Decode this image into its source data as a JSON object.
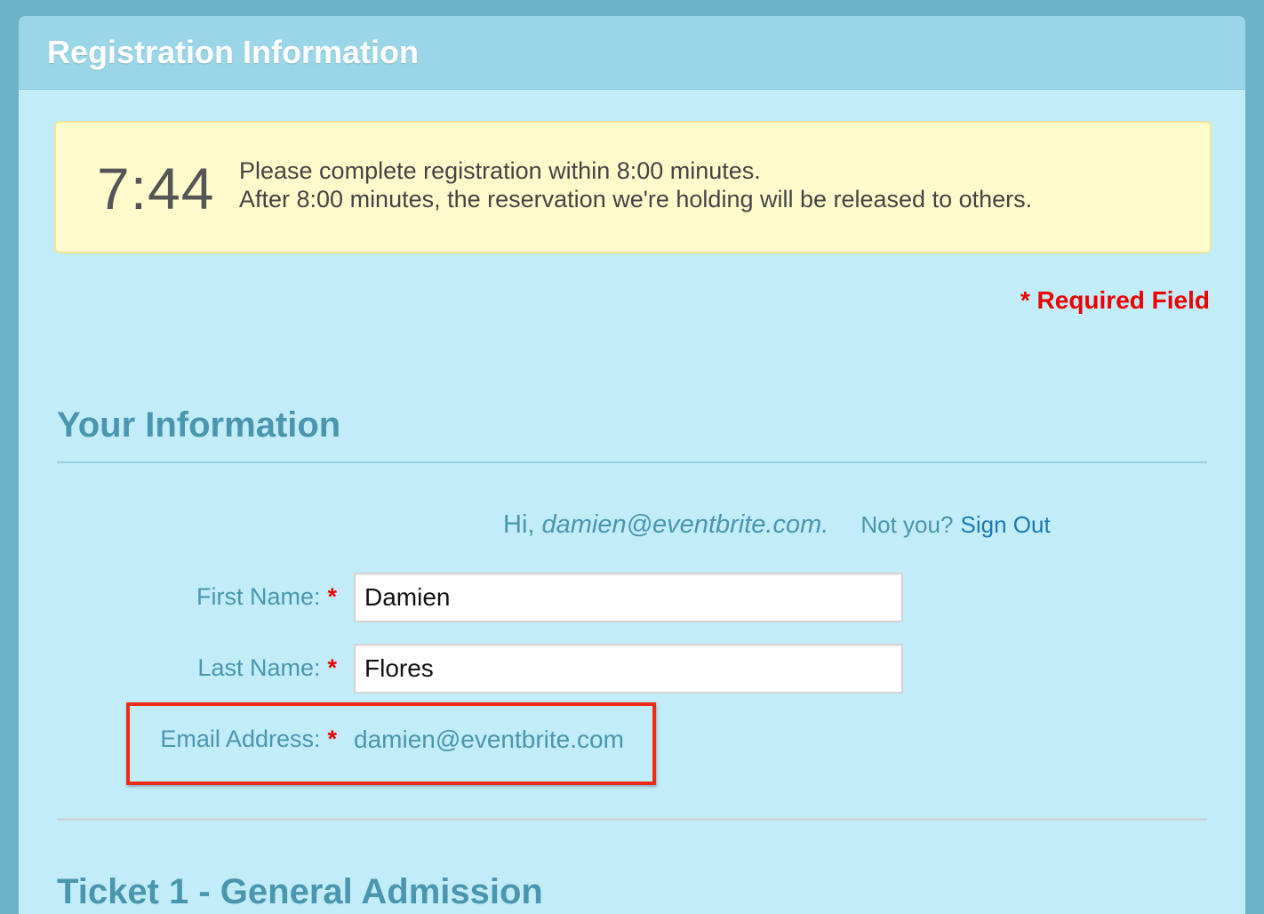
{
  "header": {
    "title": "Registration Information"
  },
  "timer": {
    "value": "7:44",
    "message_line1": "Please complete registration within 8:00 minutes.",
    "message_line2": "After 8:00 minutes, the reservation we're holding will be released to others."
  },
  "required_note": "* Required Field",
  "your_info": {
    "heading": "Your Information",
    "greeting_prefix": "Hi, ",
    "greeting_email": "damien@eventbrite.com.",
    "not_you": "Not you?",
    "sign_out": "Sign Out",
    "required_marker": "*",
    "first_name": {
      "label": "First Name:",
      "value": "Damien"
    },
    "last_name": {
      "label": "Last Name:",
      "value": "Flores"
    },
    "email": {
      "label": "Email Address:",
      "value": "damien@eventbrite.com"
    }
  },
  "ticket_section": {
    "heading": "Ticket 1 - General Admission"
  },
  "colors": {
    "page_border": "#6db3c8",
    "panel_bg": "#c1ecf8",
    "header_bg": "#9ad6e7",
    "timer_bg": "#fffacc",
    "accent_text": "#4a96ae",
    "link": "#1b78b5",
    "required": "#ee0000",
    "highlight": "#ef2a12"
  }
}
